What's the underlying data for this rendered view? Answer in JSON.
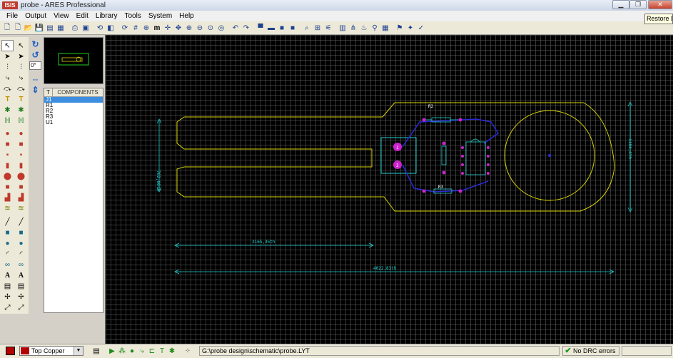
{
  "window": {
    "app_logo": "ISIS",
    "title": "probe - ARES Professional",
    "tooltip": "Restore Down"
  },
  "menu": [
    "File",
    "Output",
    "View",
    "Edit",
    "Library",
    "Tools",
    "System",
    "Help"
  ],
  "rotate": {
    "angle": "0°"
  },
  "components": {
    "tab": "T",
    "title": "COMPONENTS",
    "items": [
      "J1",
      "R1",
      "R2",
      "R3",
      "U1"
    ],
    "selected_index": 0
  },
  "pcb": {
    "labels": {
      "r2": "R2",
      "r3": "R3",
      "prong_width": "762,00th",
      "right_height": "1184,4th",
      "dim_short": "2165,35th",
      "dim_long": "4022,83th"
    },
    "colors": {
      "outline": "#d8d400",
      "dimension": "#22d0d0",
      "pad": "#cc22cc",
      "track": "#2a2ad8"
    }
  },
  "status": {
    "layer": "Top Copper",
    "path": "G:\\probe design\\schematic\\probe.LYT",
    "drc": "No DRC errors"
  }
}
